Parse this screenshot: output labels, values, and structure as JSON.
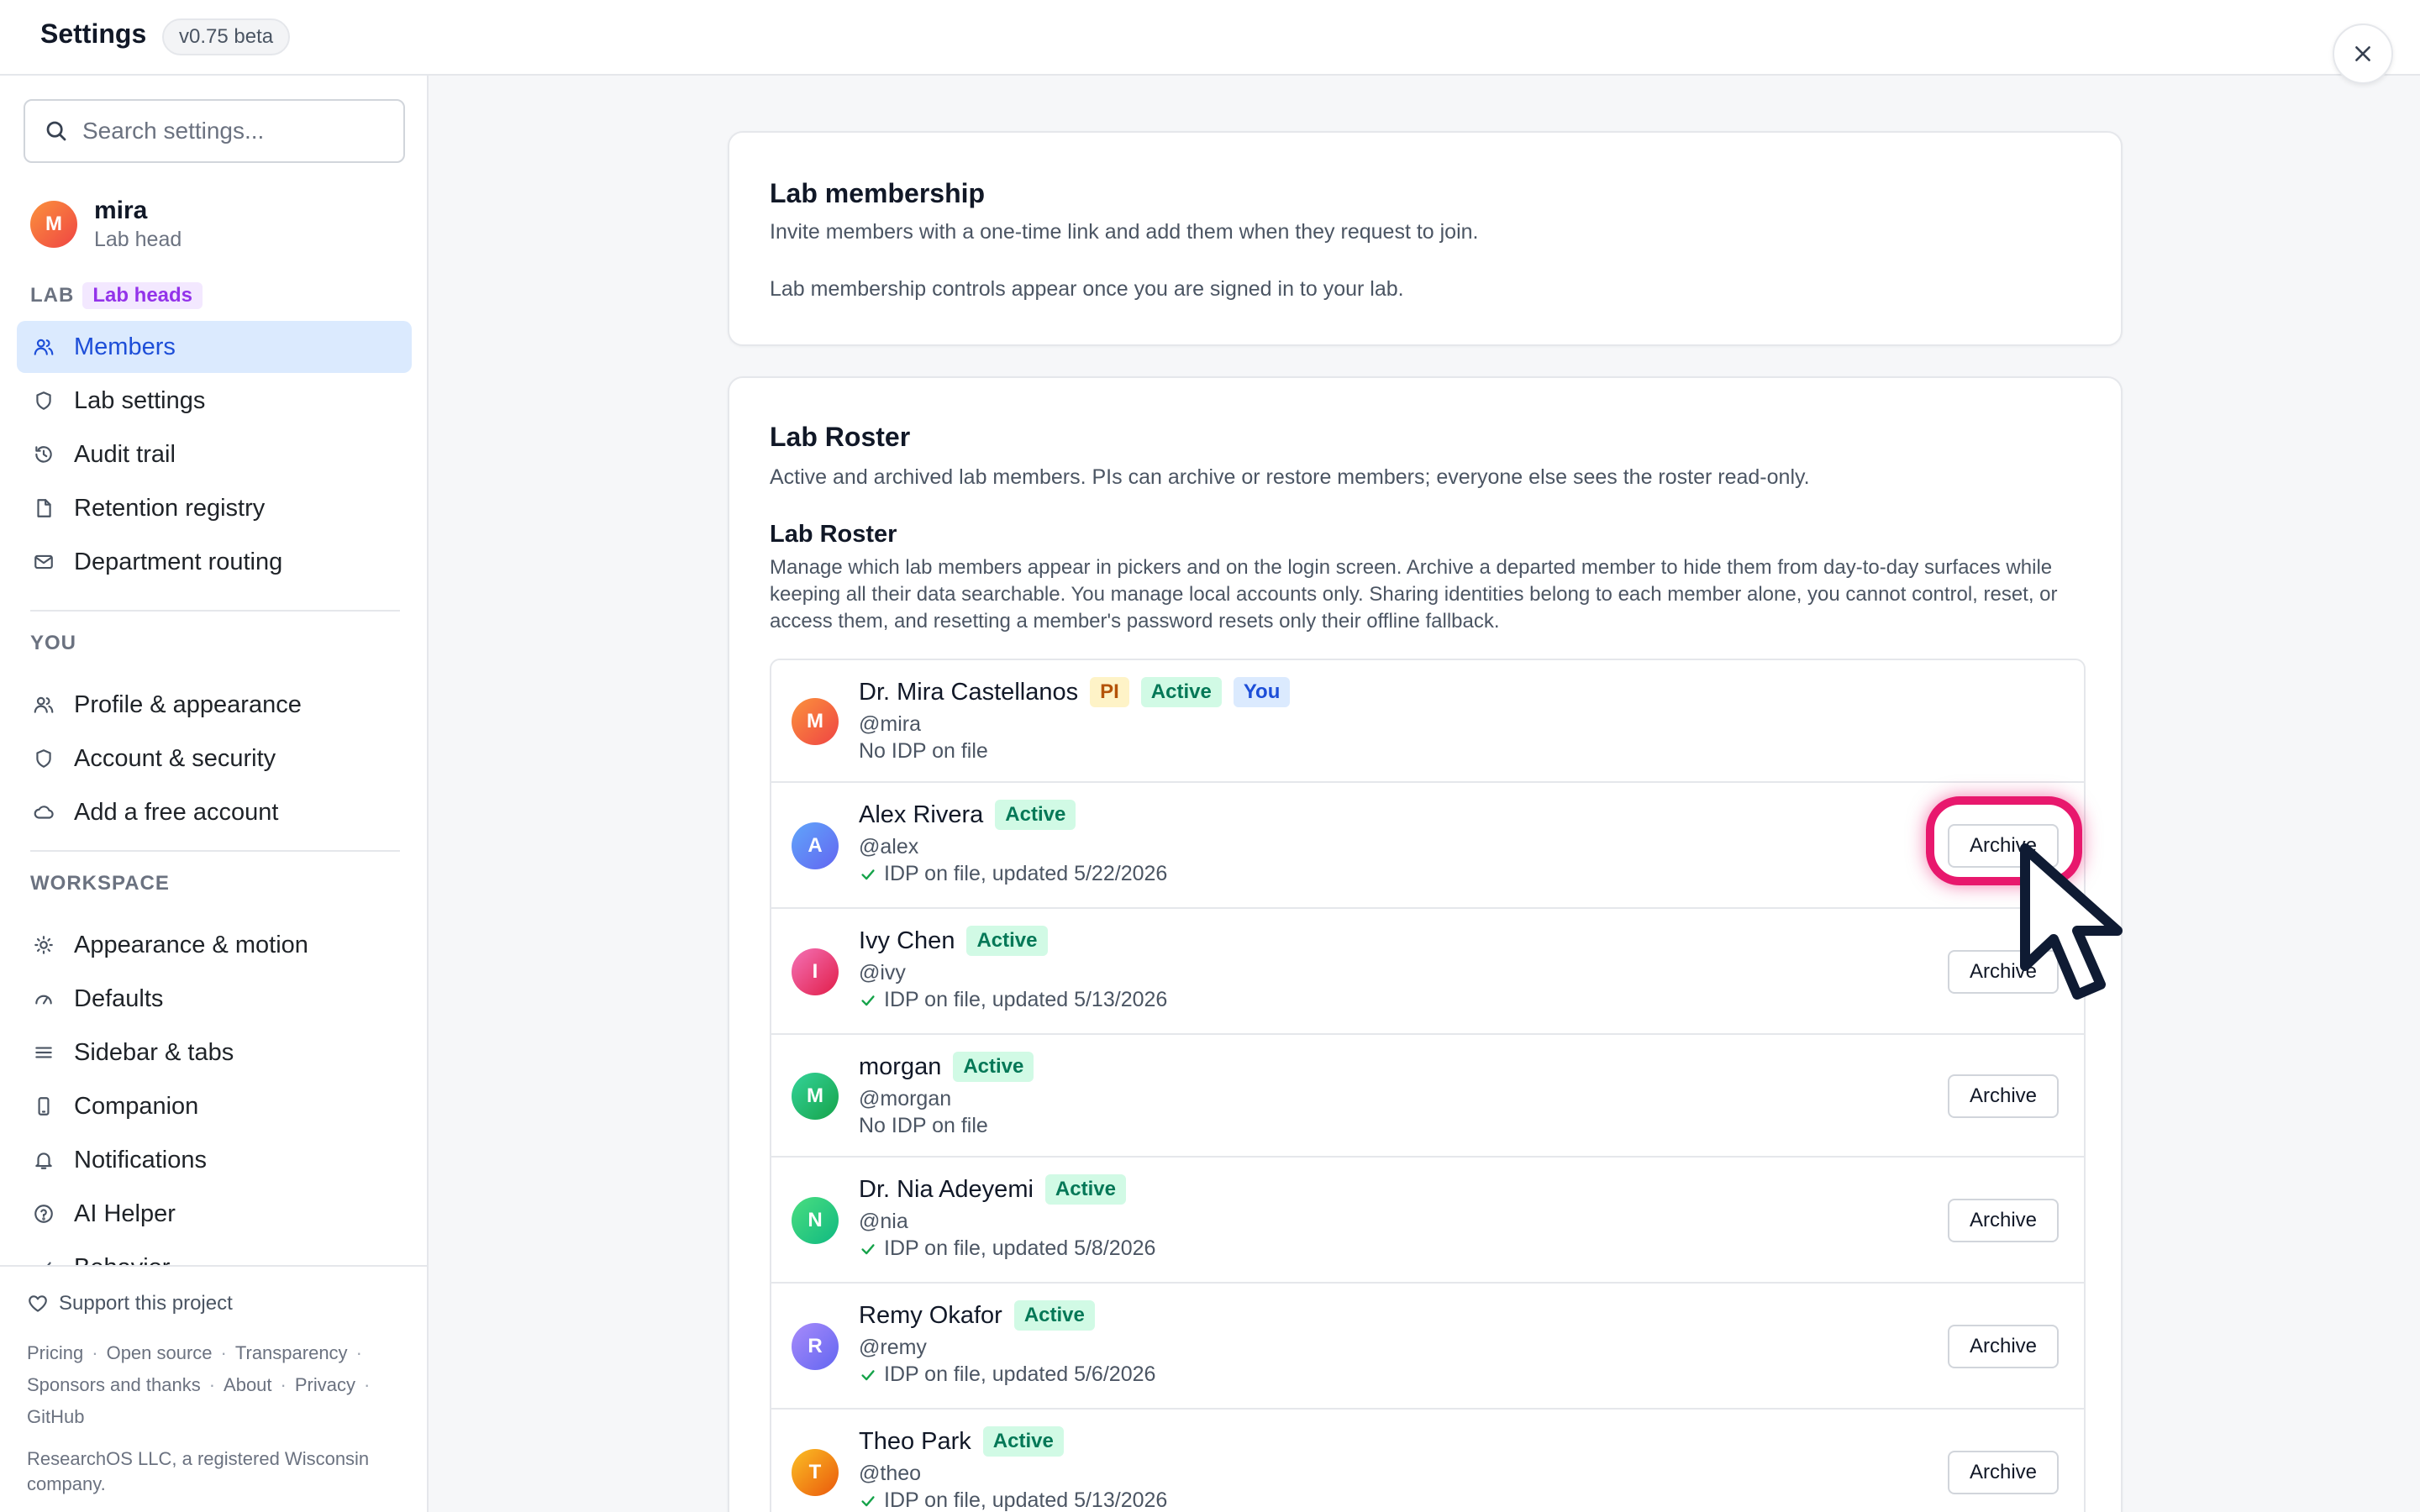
{
  "header": {
    "title": "Settings",
    "version": "v0.75 beta"
  },
  "sidebar": {
    "search_placeholder": "Search settings...",
    "user": {
      "initial": "M",
      "name": "mira",
      "role": "Lab head"
    },
    "lab_section": {
      "label": "LAB",
      "badge": "Lab heads"
    },
    "lab_items": [
      {
        "label": "Members",
        "icon": "users-icon",
        "active": true
      },
      {
        "label": "Lab settings",
        "icon": "shield-icon"
      },
      {
        "label": "Audit trail",
        "icon": "history-icon"
      },
      {
        "label": "Retention registry",
        "icon": "file-icon"
      },
      {
        "label": "Department routing",
        "icon": "mail-icon"
      }
    ],
    "you_section": {
      "label": "YOU"
    },
    "you_items": [
      {
        "label": "Profile & appearance",
        "icon": "users-icon"
      },
      {
        "label": "Account & security",
        "icon": "shield-icon"
      },
      {
        "label": "Add a free account",
        "icon": "cloud-icon"
      }
    ],
    "workspace_section": {
      "label": "WORKSPACE"
    },
    "workspace_items": [
      {
        "label": "Appearance & motion",
        "icon": "sun-icon"
      },
      {
        "label": "Defaults",
        "icon": "gauge-icon"
      },
      {
        "label": "Sidebar & tabs",
        "icon": "menu-icon"
      },
      {
        "label": "Companion",
        "icon": "phone-icon"
      },
      {
        "label": "Notifications",
        "icon": "bell-icon"
      },
      {
        "label": "AI Helper",
        "icon": "help-circle-icon"
      },
      {
        "label": "Behavior",
        "icon": "check-icon"
      }
    ],
    "footer": {
      "support": "Support this project",
      "links": [
        "Pricing",
        "Open source",
        "Transparency",
        "Sponsors and thanks",
        "About",
        "Privacy",
        "GitHub"
      ],
      "copyright": "ResearchOS LLC, a registered Wisconsin company."
    }
  },
  "membership_card": {
    "title": "Lab membership",
    "description": "Invite members with a one-time link and add them when they request to join.",
    "note": "Lab membership controls appear once you are signed in to your lab."
  },
  "roster_card": {
    "title": "Lab Roster",
    "description": "Active and archived lab members. PIs can archive or restore members; everyone else sees the roster read-only.",
    "subtitle": "Lab Roster",
    "sub_description": "Manage which lab members appear in pickers and on the login screen. Archive a departed member to hide them from day-to-day surfaces while keeping all their data searchable. You manage local accounts only. Sharing identities belong to each member alone, you cannot control, reset, or access them, and resetting a member's password resets only their offline fallback.",
    "archive_label": "Archive",
    "members": [
      {
        "initial": "M",
        "name": "Dr. Mira Castellanos",
        "handle": "@mira",
        "idp": "No IDP on file",
        "idp_ok": false,
        "badges": [
          "PI",
          "Active",
          "You"
        ],
        "color1": "#fb923c",
        "color2": "#ef4444",
        "archive": false
      },
      {
        "initial": "A",
        "name": "Alex Rivera",
        "handle": "@alex",
        "idp": "IDP on file, updated 5/22/2026",
        "idp_ok": true,
        "badges": [
          "Active"
        ],
        "color1": "#60a5fa",
        "color2": "#6366f1",
        "archive": true
      },
      {
        "initial": "I",
        "name": "Ivy Chen",
        "handle": "@ivy",
        "idp": "IDP on file, updated 5/13/2026",
        "idp_ok": true,
        "badges": [
          "Active"
        ],
        "color1": "#f472b6",
        "color2": "#e11d48",
        "archive": true
      },
      {
        "initial": "M",
        "name": "morgan",
        "handle": "@morgan",
        "idp": "No IDP on file",
        "idp_ok": false,
        "badges": [
          "Active"
        ],
        "color1": "#34d399",
        "color2": "#16a34a",
        "archive": true
      },
      {
        "initial": "N",
        "name": "Dr. Nia Adeyemi",
        "handle": "@nia",
        "idp": "IDP on file, updated 5/8/2026",
        "idp_ok": true,
        "badges": [
          "Active"
        ],
        "color1": "#4ade80",
        "color2": "#10b981",
        "archive": true
      },
      {
        "initial": "R",
        "name": "Remy Okafor",
        "handle": "@remy",
        "idp": "IDP on file, updated 5/6/2026",
        "idp_ok": true,
        "badges": [
          "Active"
        ],
        "color1": "#a78bfa",
        "color2": "#6366f1",
        "archive": true
      },
      {
        "initial": "T",
        "name": "Theo Park",
        "handle": "@theo",
        "idp": "IDP on file, updated 5/13/2026",
        "idp_ok": true,
        "badges": [
          "Active"
        ],
        "color1": "#fbbf24",
        "color2": "#ea580c",
        "archive": true
      }
    ]
  },
  "colors": {
    "accent": "#1d4ed8",
    "highlight": "#e8186d",
    "active_badge_bg": "#d1fae5",
    "active_badge_fg": "#047857"
  }
}
